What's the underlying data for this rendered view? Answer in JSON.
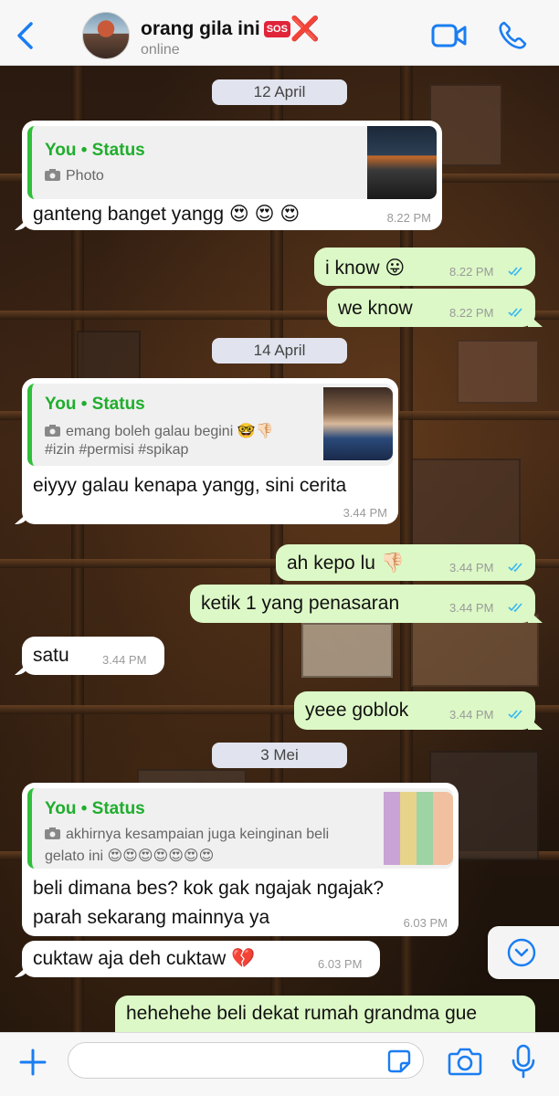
{
  "header": {
    "contact_name": "orang gila ini",
    "name_badge": "SOS",
    "name_mark": "❌",
    "status": "online"
  },
  "messages": {
    "date1": "12 April",
    "m1": {
      "quote_title": "You • Status",
      "quote_line": "Photo",
      "text": "ganteng banget yangg 😍 😍 😍",
      "time": "8.22 PM"
    },
    "m2": {
      "text": "i know 😛",
      "time": "8.22 PM"
    },
    "m3": {
      "text": "we know",
      "time": "8.22 PM"
    },
    "date2": "14 April",
    "m4": {
      "quote_title": "You • Status",
      "quote_line1": "emang boleh galau begini 🤓👎🏻",
      "quote_line2": "#izin #permisi #spikap",
      "text": "eiyyy galau kenapa yangg, sini cerita",
      "time": "3.44 PM"
    },
    "m5": {
      "text": "ah kepo lu 👎🏻",
      "time": "3.44 PM"
    },
    "m6": {
      "text": "ketik 1 yang penasaran",
      "time": "3.44 PM"
    },
    "m7": {
      "text": "satu",
      "time": "3.44 PM"
    },
    "m8": {
      "text": "yeee goblok",
      "time": "3.44 PM"
    },
    "date3": "3 Mei",
    "m9": {
      "quote_title": "You • Status",
      "quote_line1": "akhirnya kesampaian juga keinginan beli",
      "quote_line2": "gelato ini 😍😍😍😍😍😍😍",
      "text_line1": "beli dimana bes? kok gak ngajak ngajak?",
      "text_line2": "parah sekarang mainnya ya",
      "time": "6.03 PM"
    },
    "m10": {
      "text": "cuktaw aja deh cuktaw 💔",
      "time": "6.03 PM"
    },
    "m11": {
      "text": "hehehehe beli dekat rumah grandma gue"
    }
  },
  "icons": {
    "back": "chevron-left-icon",
    "video": "video-camera-icon",
    "call": "phone-icon",
    "plus": "plus-icon",
    "sticker": "sticker-icon",
    "camera": "camera-icon",
    "mic": "microphone-icon",
    "scroll": "chevron-down-circle-icon"
  },
  "colors": {
    "accent": "#1a7df2",
    "outgoing_bubble": "#dcf8c6",
    "status_green": "#1fae2c",
    "read_ticks": "#34b7f1"
  }
}
